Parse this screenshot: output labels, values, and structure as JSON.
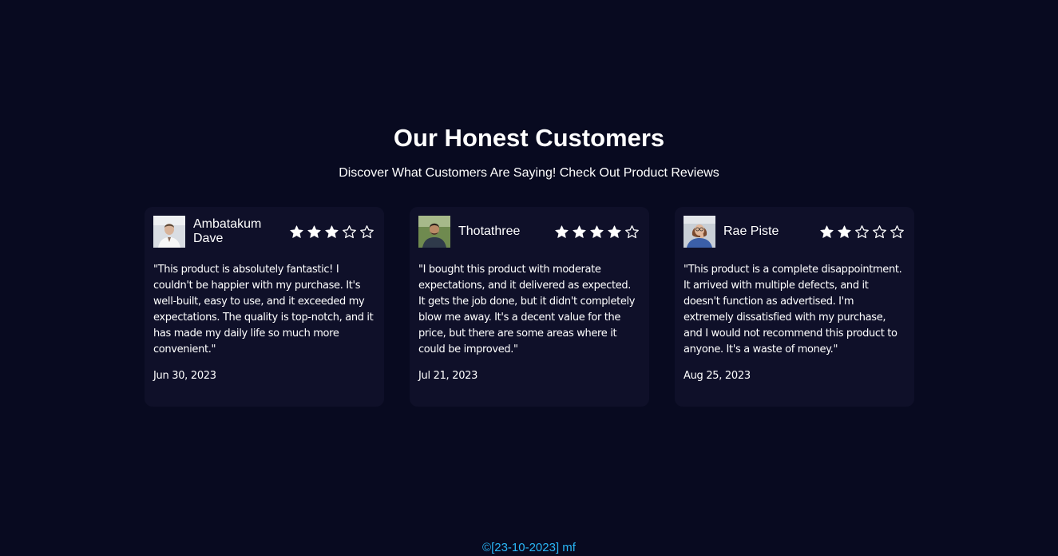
{
  "section": {
    "title": "Our Honest Customers",
    "subtitle": "Discover What Customers Are Saying! Check Out Product Reviews"
  },
  "reviews": [
    {
      "name": "Ambatakum Dave",
      "rating": 3,
      "max_rating": 5,
      "text": "\"This product is absolutely fantastic! I couldn't be happier with my purchase. It's well-built, easy to use, and it exceeded my expectations. The quality is top-notch, and it has made my daily life so much more convenient.\"",
      "date": "Jun 30, 2023",
      "avatar_icon": "user-avatar-photo-man-white-shirt"
    },
    {
      "name": "Thotathree",
      "rating": 4,
      "max_rating": 5,
      "text": "\"I bought this product with moderate expectations, and it delivered as expected. It gets the job done, but it didn't completely blow me away. It's a decent value for the price, but there are some areas where it could be improved.\"",
      "date": "Jul 21, 2023",
      "avatar_icon": "user-avatar-photo-man-outdoor"
    },
    {
      "name": "Rae Piste",
      "rating": 2,
      "max_rating": 5,
      "text": "\"This product is a complete disappointment. It arrived with multiple defects, and it doesn't function as advertised. I'm extremely dissatisfied with my purchase, and I would not recommend this product to anyone. It's a waste of money.\"",
      "date": "Aug 25, 2023",
      "avatar_icon": "user-avatar-photo-woman-glasses"
    }
  ],
  "footer": {
    "text": "©[23-10-2023] mf"
  },
  "colors": {
    "background": "#080a20",
    "card": "#0f1029",
    "text": "#ffffff",
    "footer": "#29b6f6"
  }
}
